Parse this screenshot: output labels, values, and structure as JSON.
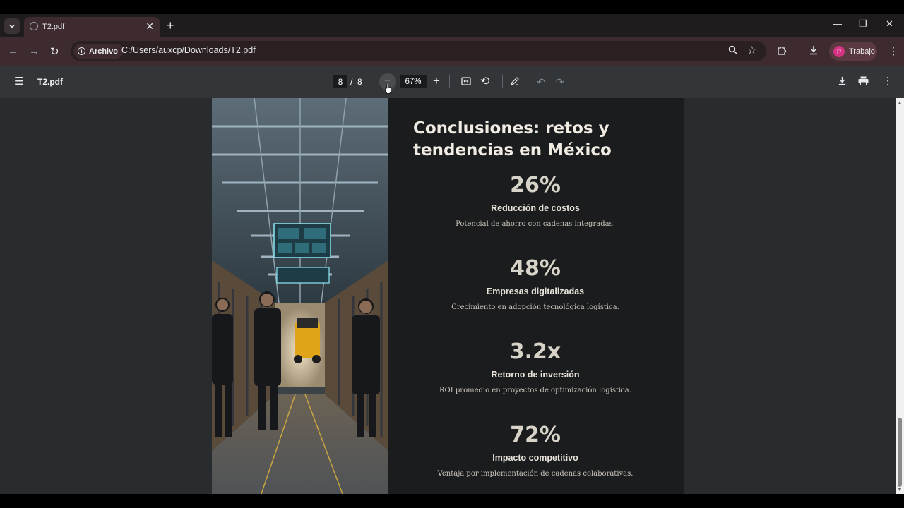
{
  "tab": {
    "title": "T2.pdf"
  },
  "addressbar": {
    "site_chip": "Archivo",
    "url": "C:/Users/auxcp/Downloads/T2.pdf"
  },
  "profile": {
    "initial": "P",
    "name": "Trabajo"
  },
  "pdf_toolbar": {
    "file_title": "T2.pdf",
    "page_current": "8",
    "page_separator": "/",
    "page_total": "8",
    "zoom": "67%"
  },
  "slide": {
    "headline": "Conclusiones: retos y tendencias en México",
    "stats": [
      {
        "value": "26%",
        "label": "Reducción de costos",
        "desc": "Potencial de ahorro con cadenas integradas."
      },
      {
        "value": "48%",
        "label": "Empresas digitalizadas",
        "desc": "Crecimiento en adopción tecnológica logística."
      },
      {
        "value": "3.2x",
        "label": "Retorno de inversión",
        "desc": "ROI promedio en proyectos de optimización logística."
      },
      {
        "value": "72%",
        "label": "Impacto competitivo",
        "desc": "Ventaja por implementación de cadenas colaborativas."
      }
    ]
  },
  "icons": {
    "tab_dropdown": "chevron-down-icon",
    "favicon": "globe-icon",
    "close": "close-icon",
    "new_tab": "plus-icon",
    "back": "back-arrow-icon",
    "forward": "forward-arrow-icon",
    "reload": "reload-icon",
    "zoom": "magnifier-icon",
    "bookmark": "star-icon",
    "extensions": "puzzle-icon",
    "downloads": "download-icon",
    "menu": "kebab-menu-icon",
    "sidebar": "hamburger-icon",
    "fit": "fit-page-icon",
    "rotate": "rotate-icon",
    "annotate": "pen-icon",
    "undo": "undo-icon",
    "redo": "redo-icon",
    "print": "printer-icon"
  },
  "colors": {
    "tab_bar": "#1f1c1d",
    "toolbar": "#3d2b2f",
    "pdf_toolbar": "#323639",
    "doc_background": "#292c2e",
    "slide_background": "#1b1c1d"
  }
}
